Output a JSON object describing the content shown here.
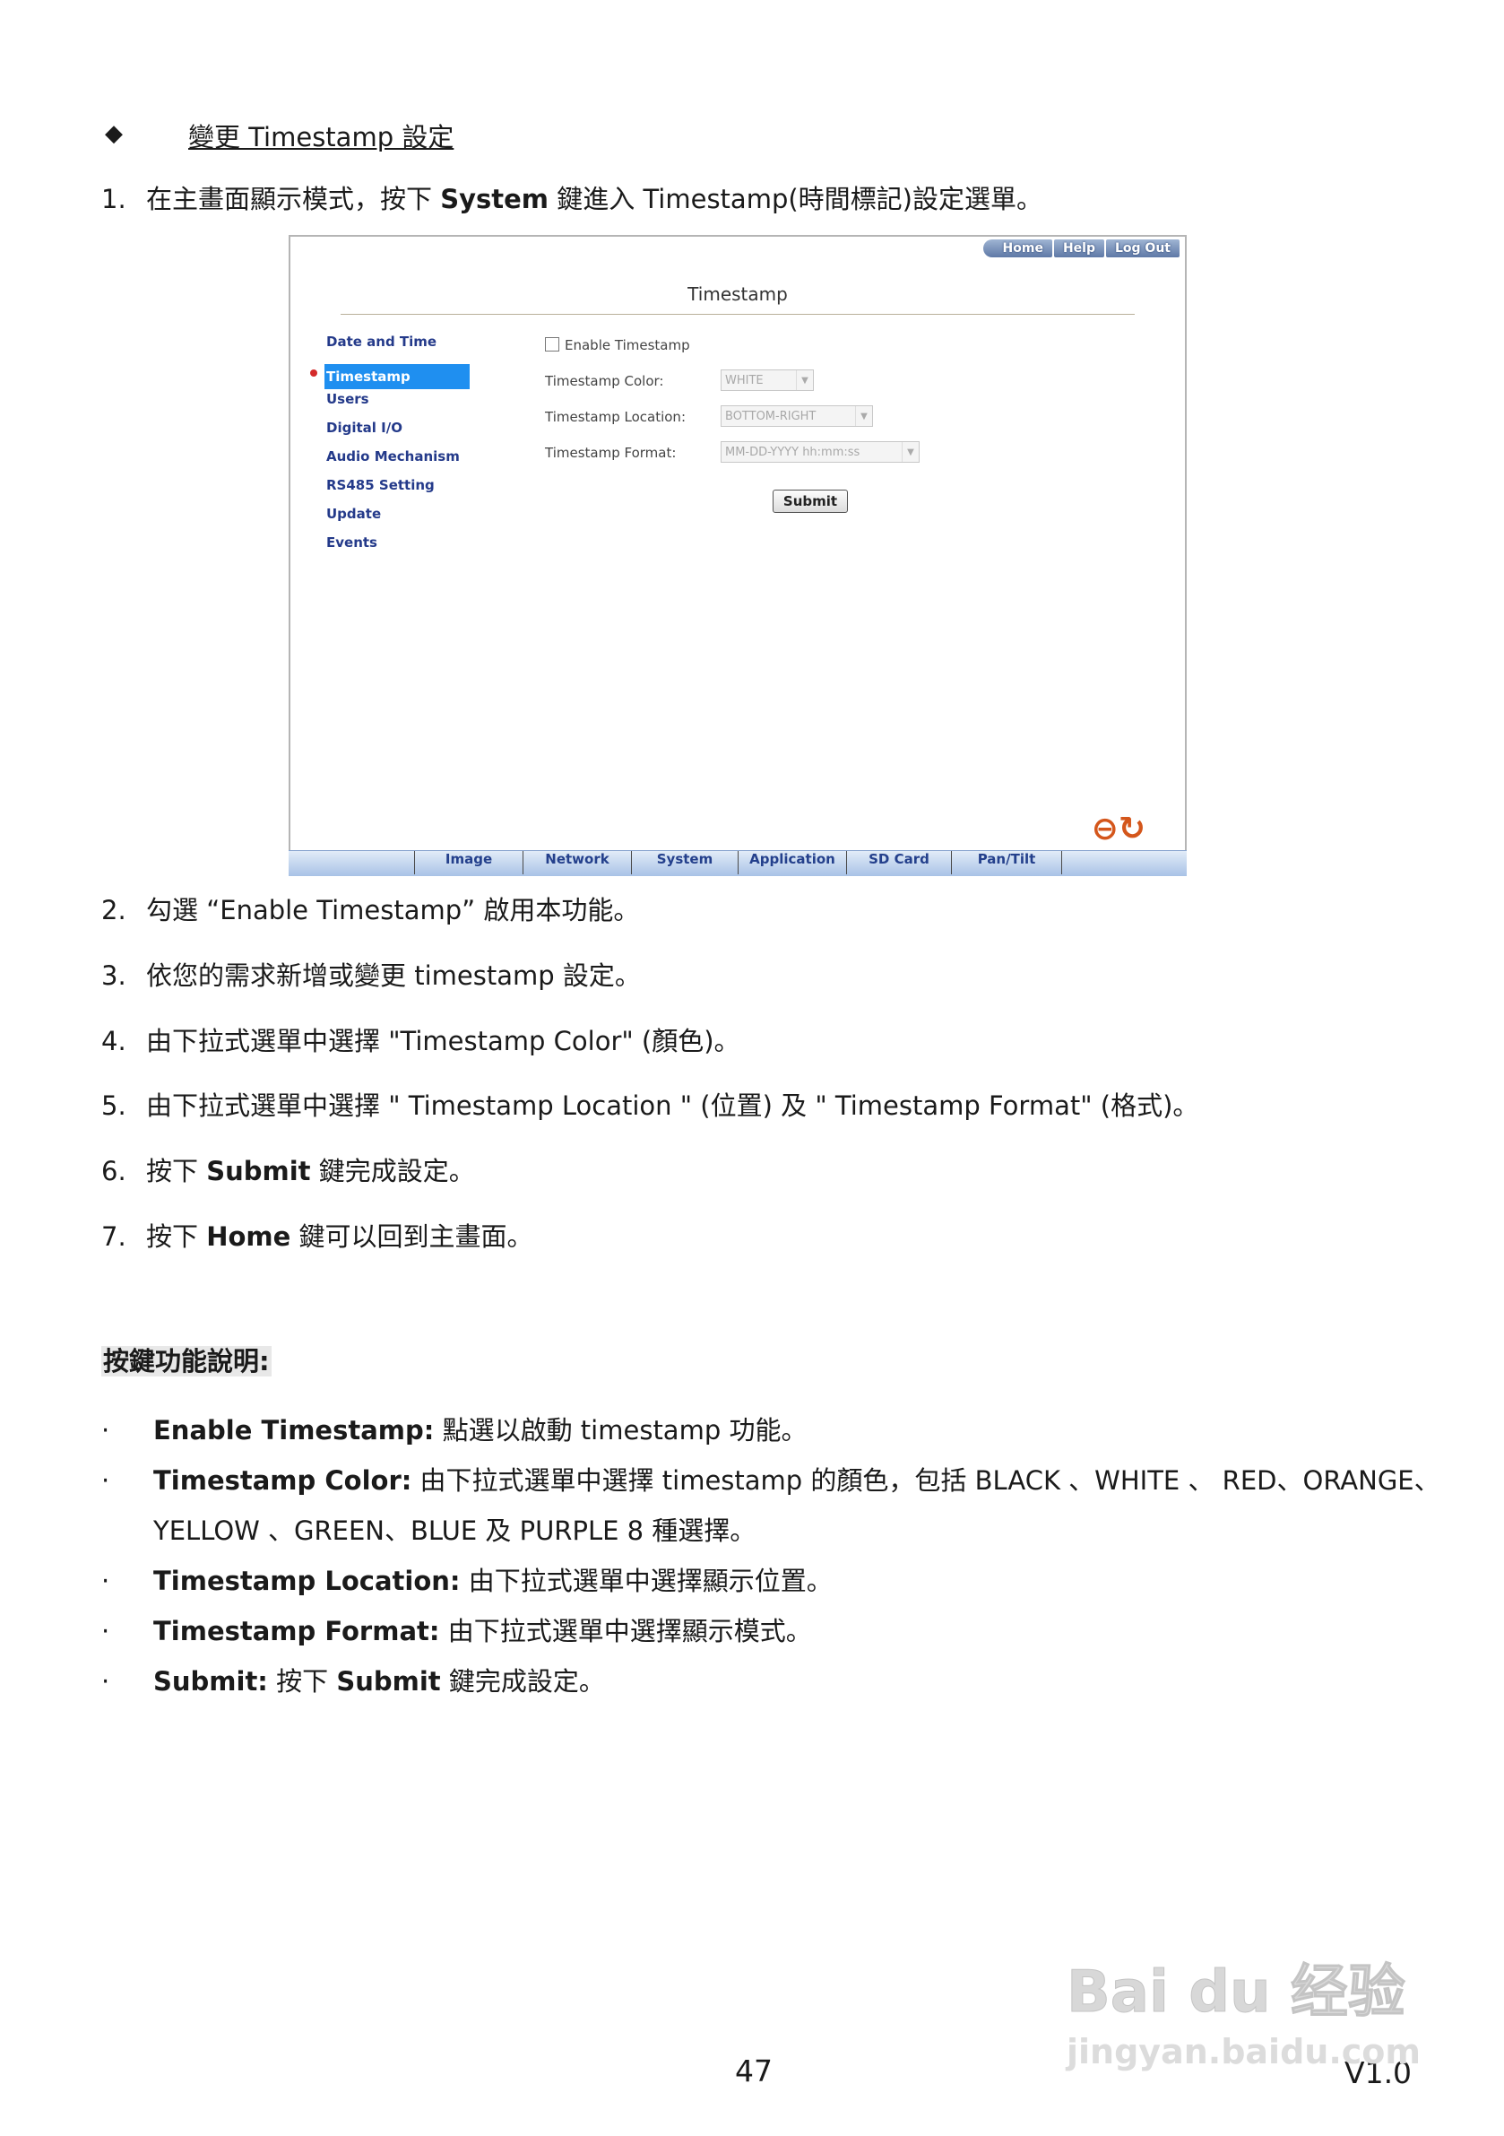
{
  "section_heading": "變更 Timestamp 設定",
  "steps": [
    {
      "num": "1.",
      "parts": [
        "在主畫面顯示模式，按下 ",
        "System",
        "  鍵進入 Timestamp(時間標記)設定選單。"
      ]
    },
    {
      "num": "2.",
      "text": "勾選 “Enable Timestamp” 啟用本功能。"
    },
    {
      "num": "3.",
      "text": "依您的需求新增或變更 timestamp 設定。"
    },
    {
      "num": "4.",
      "text": "由下拉式選單中選擇  \"Timestamp Color\" (顏色)。"
    },
    {
      "num": "5.",
      "text": "由下拉式選單中選擇  \" Timestamp Location \" (位置)  及  \" Timestamp Format\" (格式)。"
    },
    {
      "num": "6.",
      "parts": [
        "按下  ",
        "Submit",
        "  鍵完成設定。"
      ]
    },
    {
      "num": "7.",
      "parts": [
        "按下 ",
        "Home",
        " 鍵可以回到主畫面。"
      ]
    }
  ],
  "screenshot": {
    "top_nav": [
      "Home",
      "Help",
      "Log Out"
    ],
    "page_title": "Timestamp",
    "sidebar": [
      "Date and Time",
      "Timestamp",
      "Users",
      "Digital I/O",
      "Audio Mechanism",
      "RS485 Setting",
      "Update",
      "Events"
    ],
    "active_item": "Timestamp",
    "enable_label": "Enable Timestamp",
    "color_label": "Timestamp Color:",
    "color_value": "WHITE",
    "location_label": "Timestamp Location:",
    "location_value": "BOTTOM-RIGHT",
    "format_label": "Timestamp Format:",
    "format_value": "MM-DD-YYYY hh:mm:ss",
    "submit_label": "Submit",
    "bottom_tabs": [
      "Image",
      "Network",
      "System",
      "Application",
      "SD Card",
      "Pan/Tilt"
    ],
    "back_icon": "back-arrow-icon",
    "refresh_icon": "refresh-icon"
  },
  "key_functions": {
    "heading": "按鍵功能說明:",
    "items": [
      {
        "term": "Enable Timestamp:",
        "desc": " 點選以啟動 timestamp 功能。"
      },
      {
        "term": "Timestamp Color:",
        "desc": " 由下拉式選單中選擇 timestamp 的顏色，包括 BLACK   、WHITE   、   RED、ORANGE、",
        "desc2": "YELLOW   、GREEN、BLUE  及  PURPLE 8 種選擇。"
      },
      {
        "term": "Timestamp Location:",
        "desc": " 由下拉式選單中選擇顯示位置。"
      },
      {
        "term": "Timestamp Format:",
        "desc": " 由下拉式選單中選擇顯示模式。"
      },
      {
        "term": "Submit:",
        "desc": "  按下 ",
        "term2": "Submit",
        "desc3": " 鍵完成設定。"
      }
    ]
  },
  "page_number": "47",
  "version": "V1.0",
  "watermark": {
    "brand": "Bai du 经验",
    "url": "jingyan.baidu.com"
  }
}
